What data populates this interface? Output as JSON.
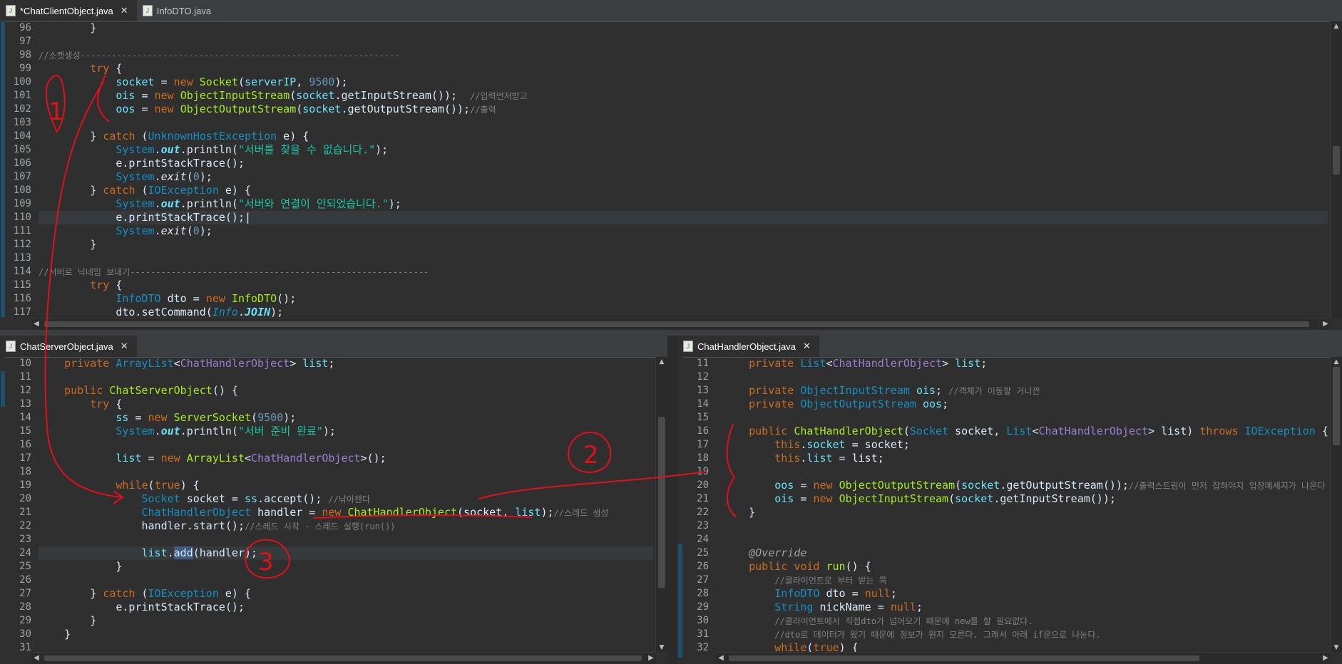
{
  "top": {
    "tabs": [
      {
        "label": "*ChatClientObject.java",
        "active": true,
        "closable": true
      },
      {
        "label": "InfoDTO.java",
        "active": false,
        "closable": false
      }
    ],
    "line_numbers": [
      "96",
      "97",
      "98",
      "99",
      "100",
      "101",
      "102",
      "103",
      "104",
      "105",
      "106",
      "107",
      "108",
      "109",
      "110",
      "111",
      "112",
      "113",
      "114",
      "115",
      "116",
      "117"
    ]
  },
  "bottom_left": {
    "tab": "ChatServerObject.java",
    "line_numbers": [
      "10",
      "11",
      "12",
      "13",
      "14",
      "15",
      "16",
      "17",
      "18",
      "19",
      "20",
      "21",
      "22",
      "23",
      "24",
      "25",
      "26",
      "27",
      "28",
      "29",
      "30",
      "31"
    ]
  },
  "bottom_right": {
    "tab": "ChatHandlerObject.java",
    "line_numbers": [
      "11",
      "12",
      "13",
      "14",
      "15",
      "16",
      "17",
      "18",
      "19",
      "20",
      "21",
      "22",
      "23",
      "24",
      "25",
      "26",
      "27",
      "28",
      "29",
      "30",
      "31",
      "32"
    ]
  },
  "annotations": [
    "1",
    "2",
    "3"
  ],
  "colors": {
    "keyword": "#cc6c1d",
    "type": "#1290c3",
    "class": "#9a7ed1",
    "field": "#66e1f8",
    "comment": "#808080",
    "string": "#17c6a3",
    "number": "#6897bb",
    "annotation_ink": "#e0101a"
  }
}
